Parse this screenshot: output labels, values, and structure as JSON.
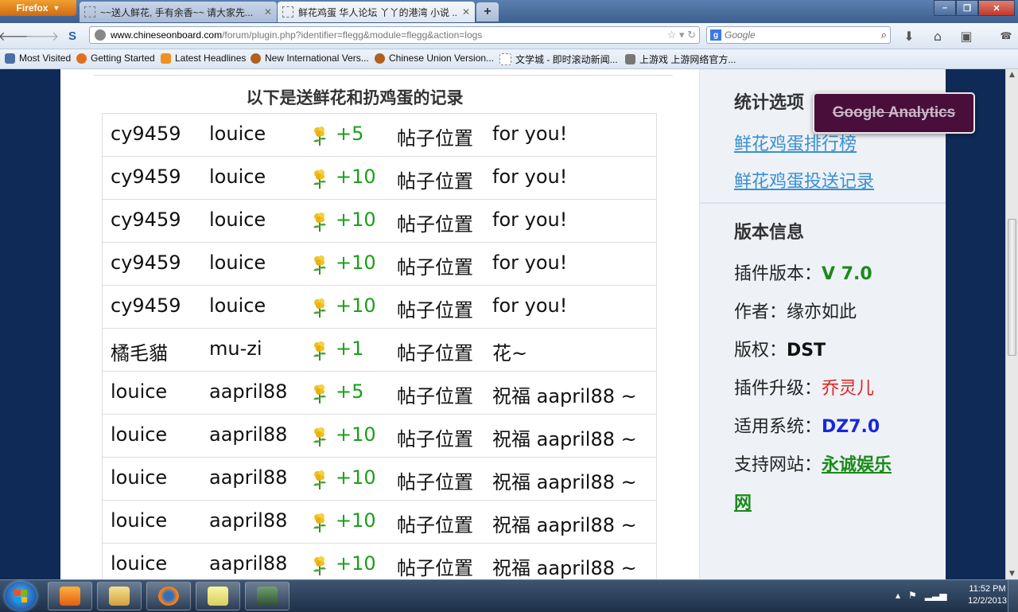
{
  "browser": {
    "app_button": "Firefox",
    "tabs": [
      {
        "title": "~~送人鲜花, 手有余香~~ 请大家先...",
        "active": false
      },
      {
        "title": "鲜花鸡蛋 华人论坛 丫丫的港湾 小说 ...",
        "active": true
      }
    ],
    "url_domain": "www.chineseonboard.com",
    "url_path": "/forum/plugin.php?identifier=flegg&module=flegg&action=logs",
    "search_placeholder": "Google",
    "bookmarks": [
      {
        "label": "Most Visited",
        "icon": "bookmarks-icon",
        "color": "#4a6fa5"
      },
      {
        "label": "Getting Started",
        "icon": "firefox-icon",
        "color": "#e07020"
      },
      {
        "label": "Latest Headlines",
        "icon": "rss-icon",
        "color": "#f09020"
      },
      {
        "label": "New International Vers...",
        "icon": "site-icon",
        "color": "#b06020"
      },
      {
        "label": "Chinese Union Version...",
        "icon": "site-icon",
        "color": "#b06020"
      },
      {
        "label": "文学城 - 即时滚动新闻...",
        "icon": "page-icon",
        "color": "#999999"
      },
      {
        "label": "上游戏 上游网络官方...",
        "icon": "site-icon",
        "color": "#555555"
      }
    ]
  },
  "page": {
    "records_title": "以下是送鲜花和扔鸡蛋的记录",
    "records": [
      {
        "from": "cy9459",
        "to": "louice",
        "amount": "+5",
        "position": "帖子位置",
        "message": "for you!"
      },
      {
        "from": "cy9459",
        "to": "louice",
        "amount": "+10",
        "position": "帖子位置",
        "message": "for you!"
      },
      {
        "from": "cy9459",
        "to": "louice",
        "amount": "+10",
        "position": "帖子位置",
        "message": "for you!"
      },
      {
        "from": "cy9459",
        "to": "louice",
        "amount": "+10",
        "position": "帖子位置",
        "message": "for you!"
      },
      {
        "from": "cy9459",
        "to": "louice",
        "amount": "+10",
        "position": "帖子位置",
        "message": "for you!"
      },
      {
        "from": "橘毛貓",
        "to": "mu-zi",
        "amount": "+1",
        "position": "帖子位置",
        "message": "花~"
      },
      {
        "from": "louice",
        "to": "aapril88",
        "amount": "+5",
        "position": "帖子位置",
        "message": "祝福 aapril88 ~"
      },
      {
        "from": "louice",
        "to": "aapril88",
        "amount": "+10",
        "position": "帖子位置",
        "message": "祝福 aapril88 ~"
      },
      {
        "from": "louice",
        "to": "aapril88",
        "amount": "+10",
        "position": "帖子位置",
        "message": "祝福 aapril88 ~"
      },
      {
        "from": "louice",
        "to": "aapril88",
        "amount": "+10",
        "position": "帖子位置",
        "message": "祝福 aapril88 ~"
      },
      {
        "from": "louice",
        "to": "aapril88",
        "amount": "+10",
        "position": "帖子位置",
        "message": "祝福 aapril88 ~"
      }
    ],
    "sidebar": {
      "stats_heading": "统计选项",
      "links": [
        "鲜花鸡蛋排行榜",
        "鲜花鸡蛋投送记录"
      ],
      "version_heading": "版本信息",
      "info": [
        {
          "label": "插件版本：",
          "value": "V 7.0"
        },
        {
          "label": "作者：",
          "value": "缘亦如此"
        },
        {
          "label": "版权：",
          "value": "DST"
        },
        {
          "label": "插件升级：",
          "value": "乔灵儿"
        },
        {
          "label": "适用系统：",
          "value": "DZ7.0"
        },
        {
          "label": "支持网站：",
          "value": "永诚娱乐"
        },
        {
          "label": "",
          "value": "网"
        }
      ]
    },
    "ga_badge": "Google Analytics"
  },
  "taskbar": {
    "time": "11:52 PM",
    "date": "12/2/2013"
  }
}
